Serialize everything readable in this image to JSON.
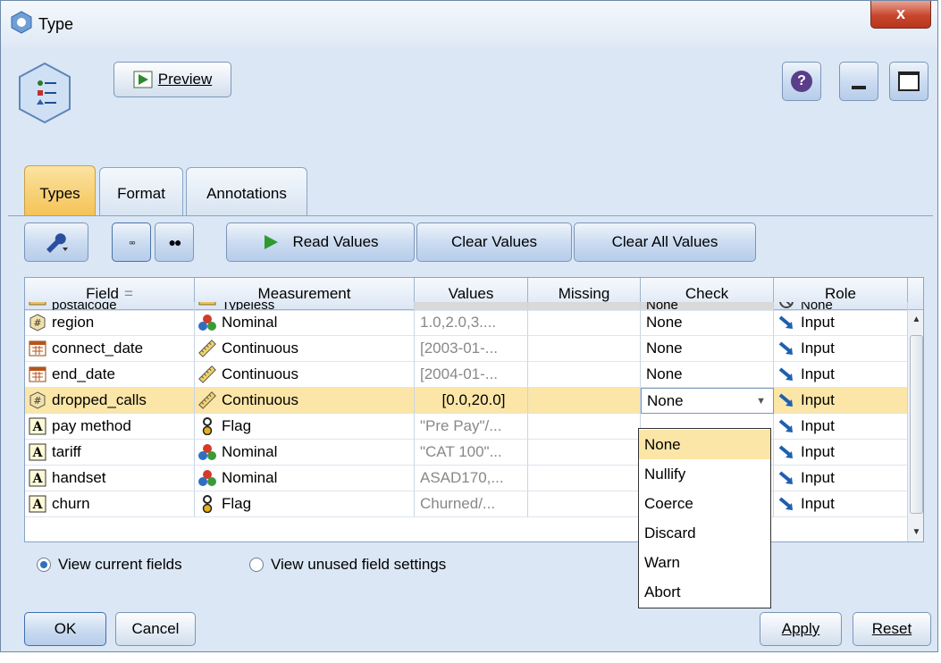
{
  "window": {
    "title": "Type",
    "close_label": "x"
  },
  "toolbar": {
    "preview_label": "Preview",
    "help_label": "?"
  },
  "tabs": [
    {
      "label": "Types",
      "active": true
    },
    {
      "label": "Format",
      "active": false
    },
    {
      "label": "Annotations",
      "active": false
    }
  ],
  "actions": {
    "read_values": "Read Values",
    "clear_values": "Clear Values",
    "clear_all_values": "Clear All Values"
  },
  "table": {
    "headers": [
      "Field",
      "Measurement",
      "Values",
      "Missing",
      "Check",
      "Role"
    ],
    "sort_indicator": "=",
    "rows": [
      {
        "field": "postalcode",
        "type_icon": "typeless-icon",
        "measurement": "Typeless",
        "meas_icon": "typeless-icon",
        "values": "",
        "missing": "",
        "check": "None",
        "role": "None",
        "role_icon": "none-role-icon",
        "clipped": true
      },
      {
        "field": "region",
        "type_icon": "real-icon",
        "measurement": "Nominal",
        "meas_icon": "nominal-icon",
        "values": "1.0,2.0,3....",
        "missing": "",
        "check": "None",
        "role": "Input",
        "role_icon": "input-arrow-icon"
      },
      {
        "field": "connect_date",
        "type_icon": "date-icon",
        "measurement": "Continuous",
        "meas_icon": "continuous-icon",
        "values": "[2003-01-...",
        "missing": "",
        "check": "None",
        "role": "Input",
        "role_icon": "input-arrow-icon"
      },
      {
        "field": "end_date",
        "type_icon": "date-icon",
        "measurement": "Continuous",
        "meas_icon": "continuous-icon",
        "values": "[2004-01-...",
        "missing": "",
        "check": "None",
        "role": "Input",
        "role_icon": "input-arrow-icon"
      },
      {
        "field": "dropped_calls",
        "type_icon": "real-icon",
        "measurement": "Continuous",
        "meas_icon": "continuous-icon",
        "values": "[0.0,20.0]",
        "missing": "",
        "check": "None",
        "role": "Input",
        "role_icon": "input-arrow-icon",
        "selected": true
      },
      {
        "field": "pay method",
        "type_icon": "string-icon",
        "measurement": "Flag",
        "meas_icon": "flag-icon",
        "values": "\"Pre Pay\"/...",
        "missing": "",
        "check": "",
        "role": "Input",
        "role_icon": "input-arrow-icon"
      },
      {
        "field": "tariff",
        "type_icon": "string-icon",
        "measurement": "Nominal",
        "meas_icon": "nominal-icon",
        "values": "\"CAT 100\"...",
        "missing": "",
        "check": "",
        "role": "Input",
        "role_icon": "input-arrow-icon"
      },
      {
        "field": "handset",
        "type_icon": "string-icon",
        "measurement": "Nominal",
        "meas_icon": "nominal-icon",
        "values": "ASAD170,...",
        "missing": "",
        "check": "",
        "role": "Input",
        "role_icon": "input-arrow-icon"
      },
      {
        "field": "churn",
        "type_icon": "string-icon",
        "measurement": "Flag",
        "meas_icon": "flag-icon",
        "values": "Churned/...",
        "missing": "",
        "check": "",
        "role": "Input",
        "role_icon": "input-arrow-icon"
      }
    ]
  },
  "check_dropdown": {
    "selected": "None",
    "options": [
      "None",
      "Nullify",
      "Coerce",
      "Discard",
      "Warn",
      "Abort"
    ]
  },
  "view_options": {
    "current_fields": "View current fields",
    "unused_settings": "View unused field settings",
    "selected": "current_fields"
  },
  "footer": {
    "ok": "OK",
    "cancel": "Cancel",
    "apply": "Apply",
    "reset": "Reset"
  },
  "colors": {
    "selection": "#fbe6a8",
    "active_tab": "#f4c357",
    "window_bg": "#dbe7f5",
    "role_arrow": "#1f5fb0"
  }
}
